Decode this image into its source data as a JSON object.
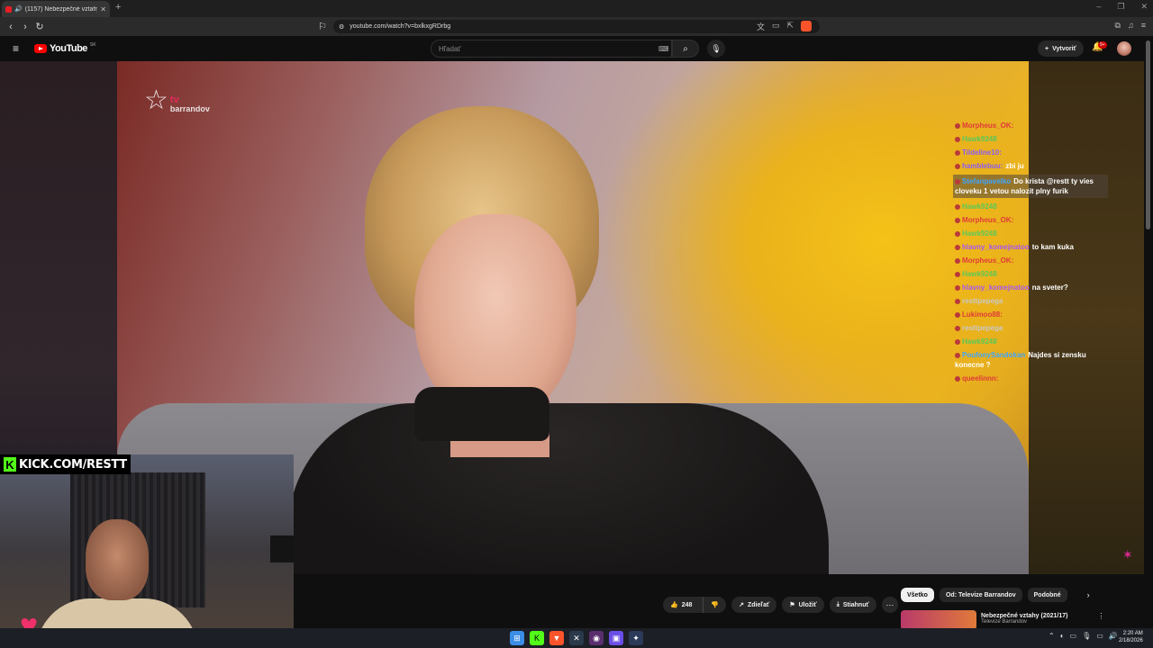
{
  "browser": {
    "tab_title": "(1157) Nebezpečné vztahy (2",
    "url": "youtube.com/watch?v=bxlkxgRDrbg"
  },
  "youtube": {
    "logo_text": "YouTube",
    "country_code": "SK",
    "search_placeholder": "Hľadať",
    "create_label": "Vytvoriť",
    "notifications_badge": "9+"
  },
  "stream_overlay": {
    "channel_logo_tv": "tv",
    "channel_logo_name": "barrandov",
    "kick_banner": "KICK.COM/RESTT"
  },
  "chat": [
    {
      "user": "Morpheus_OK:",
      "text": "",
      "user_color": "#e03a3a"
    },
    {
      "user": "Hawk9248",
      "text": "",
      "user_color": "#5ac85a"
    },
    {
      "user": "Tildeline10:",
      "text": "",
      "user_color": "#8b5cf6"
    },
    {
      "user": "hamblebuu:",
      "text": "zbi ju",
      "user_color": "#8b5cf6"
    },
    {
      "user": "Stefanpavelko",
      "text": "Do krista @restt ty vies cloveku 1 vetou nalozit plny furik",
      "user_color": "#3ea6ff"
    },
    {
      "user": "Hawk9248",
      "text": "",
      "user_color": "#5ac85a"
    },
    {
      "user": "Morpheus_OK:",
      "text": "",
      "user_color": "#e03a3a"
    },
    {
      "user": "Hawk9248",
      "text": "",
      "user_color": "#5ac85a"
    },
    {
      "user": "hlavny_komejnatoo",
      "text": "to kam kuka",
      "user_color": "#a855f7"
    },
    {
      "user": "Morpheus_OK:",
      "text": "",
      "user_color": "#e03a3a"
    },
    {
      "user": "Hawk9248",
      "text": "",
      "user_color": "#5ac85a"
    },
    {
      "user": "hlavny_komejnatoo",
      "text": "na sveter?",
      "user_color": "#a855f7"
    },
    {
      "user": "resttpepega",
      "text": "",
      "user_color": "#c8c8c8"
    },
    {
      "user": "Lukimoo88:",
      "text": "",
      "user_color": "#e03a3a"
    },
    {
      "user": "resttpepega",
      "text": "",
      "user_color": "#c8c8c8"
    },
    {
      "user": "Hawk9248",
      "text": "",
      "user_color": "#5ac85a"
    },
    {
      "user": "PoufonySandokan",
      "text": "Najdes si zensku konecne ?",
      "user_color": "#3ea6ff"
    },
    {
      "user": "queelinnn:",
      "text": "",
      "user_color": "#e03a3a"
    }
  ],
  "actions": {
    "like_count": "248",
    "share_label": "Zdieľať",
    "save_label": "Uložiť",
    "download_label": "Stiahnuť"
  },
  "chips": [
    "Všetko",
    "Od: Televize Barrandov",
    "Podobné"
  ],
  "recommendation": {
    "title": "Nebezpečné vztahy (2021/17)",
    "channel": "Televize Barrandov"
  },
  "taskbar": {
    "time": "2:20 AM",
    "date": "2/18/2026"
  }
}
